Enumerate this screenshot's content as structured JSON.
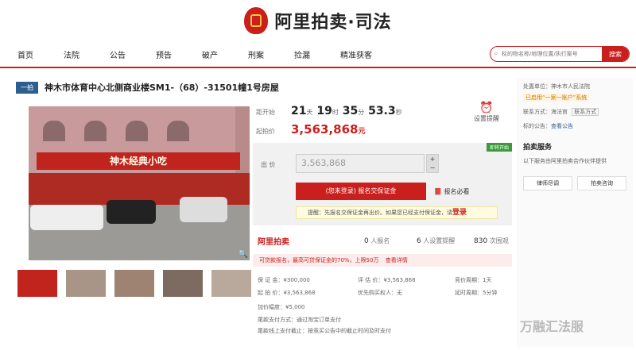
{
  "header": {
    "logo_text": "阿里拍卖·司法"
  },
  "nav": [
    "首页",
    "法院",
    "公告",
    "预告",
    "破产",
    "刑案",
    "捡漏",
    "精准获客"
  ],
  "search": {
    "placeholder": "标的物名称/地理位置/执行案号",
    "button": "搜索"
  },
  "item": {
    "badge": "一拍",
    "title": "神木市体育中心北侧商业楼SM1-（68）-31501幢1号房屋",
    "photo_sign": "神木经典小吃",
    "countdown_label": "距开始",
    "countdown": {
      "days": "21",
      "days_unit": "天",
      "hours": "19",
      "hours_unit": "时",
      "mins": "35",
      "mins_unit": "分",
      "secs": "53.3",
      "secs_unit": "秒"
    },
    "start_price_label": "起拍价",
    "start_price": "3,563,868",
    "start_price_unit": "元",
    "remind": "设置提醒",
    "bid_label": "出 价",
    "bid_value": "3,563,868",
    "green_tag": "即将开始",
    "enroll_button": "(您未登录) 报名交保证金",
    "must_read": "报名必看",
    "notice_prefix": "提醒：先报名交保证金再出价。如果您已经支付保证金，请",
    "notice_link": "登录"
  },
  "stats": {
    "brand": "阿里拍卖",
    "enrolled": "0",
    "enrolled_label": "人报名",
    "reminders": "6",
    "reminders_label": "人设置提醒",
    "views": "830",
    "views_label": "次围观"
  },
  "loan": {
    "text": "可贷款报名，最高可贷保证金的70%，上限50万",
    "link": "查看详情"
  },
  "details": {
    "deposit": "保 证 金：¥300,000",
    "appraisal": "评 估 价：¥3,563,868",
    "period": "竞价周期：1天",
    "start": "起 拍 价：¥3,563,868",
    "priority": "优先购买权人：无",
    "delay": "延时周期：5分钟",
    "increment": "加价幅度：¥5,000",
    "payment": "尾款支付方式：通过淘宝订单支付",
    "deadline": "尾款线上支付截止：按竞买公告中的截止时间及时支付"
  },
  "right": {
    "court_label": "处置单位：",
    "court": "神木市人民法院",
    "badge": "已启用“一案一账户”系统",
    "contact_label": "联系方式：",
    "contact": "海法官",
    "contact_btn": "联系方式",
    "notice_label": "标的公告：",
    "notice_link": "查看公告",
    "service_title": "拍卖服务",
    "service_desc": "以下服务由阿里拍卖合作伙伴提供",
    "btn1": "律师尽调",
    "btn2": "拍卖咨询"
  },
  "watermark": "万融汇法服"
}
